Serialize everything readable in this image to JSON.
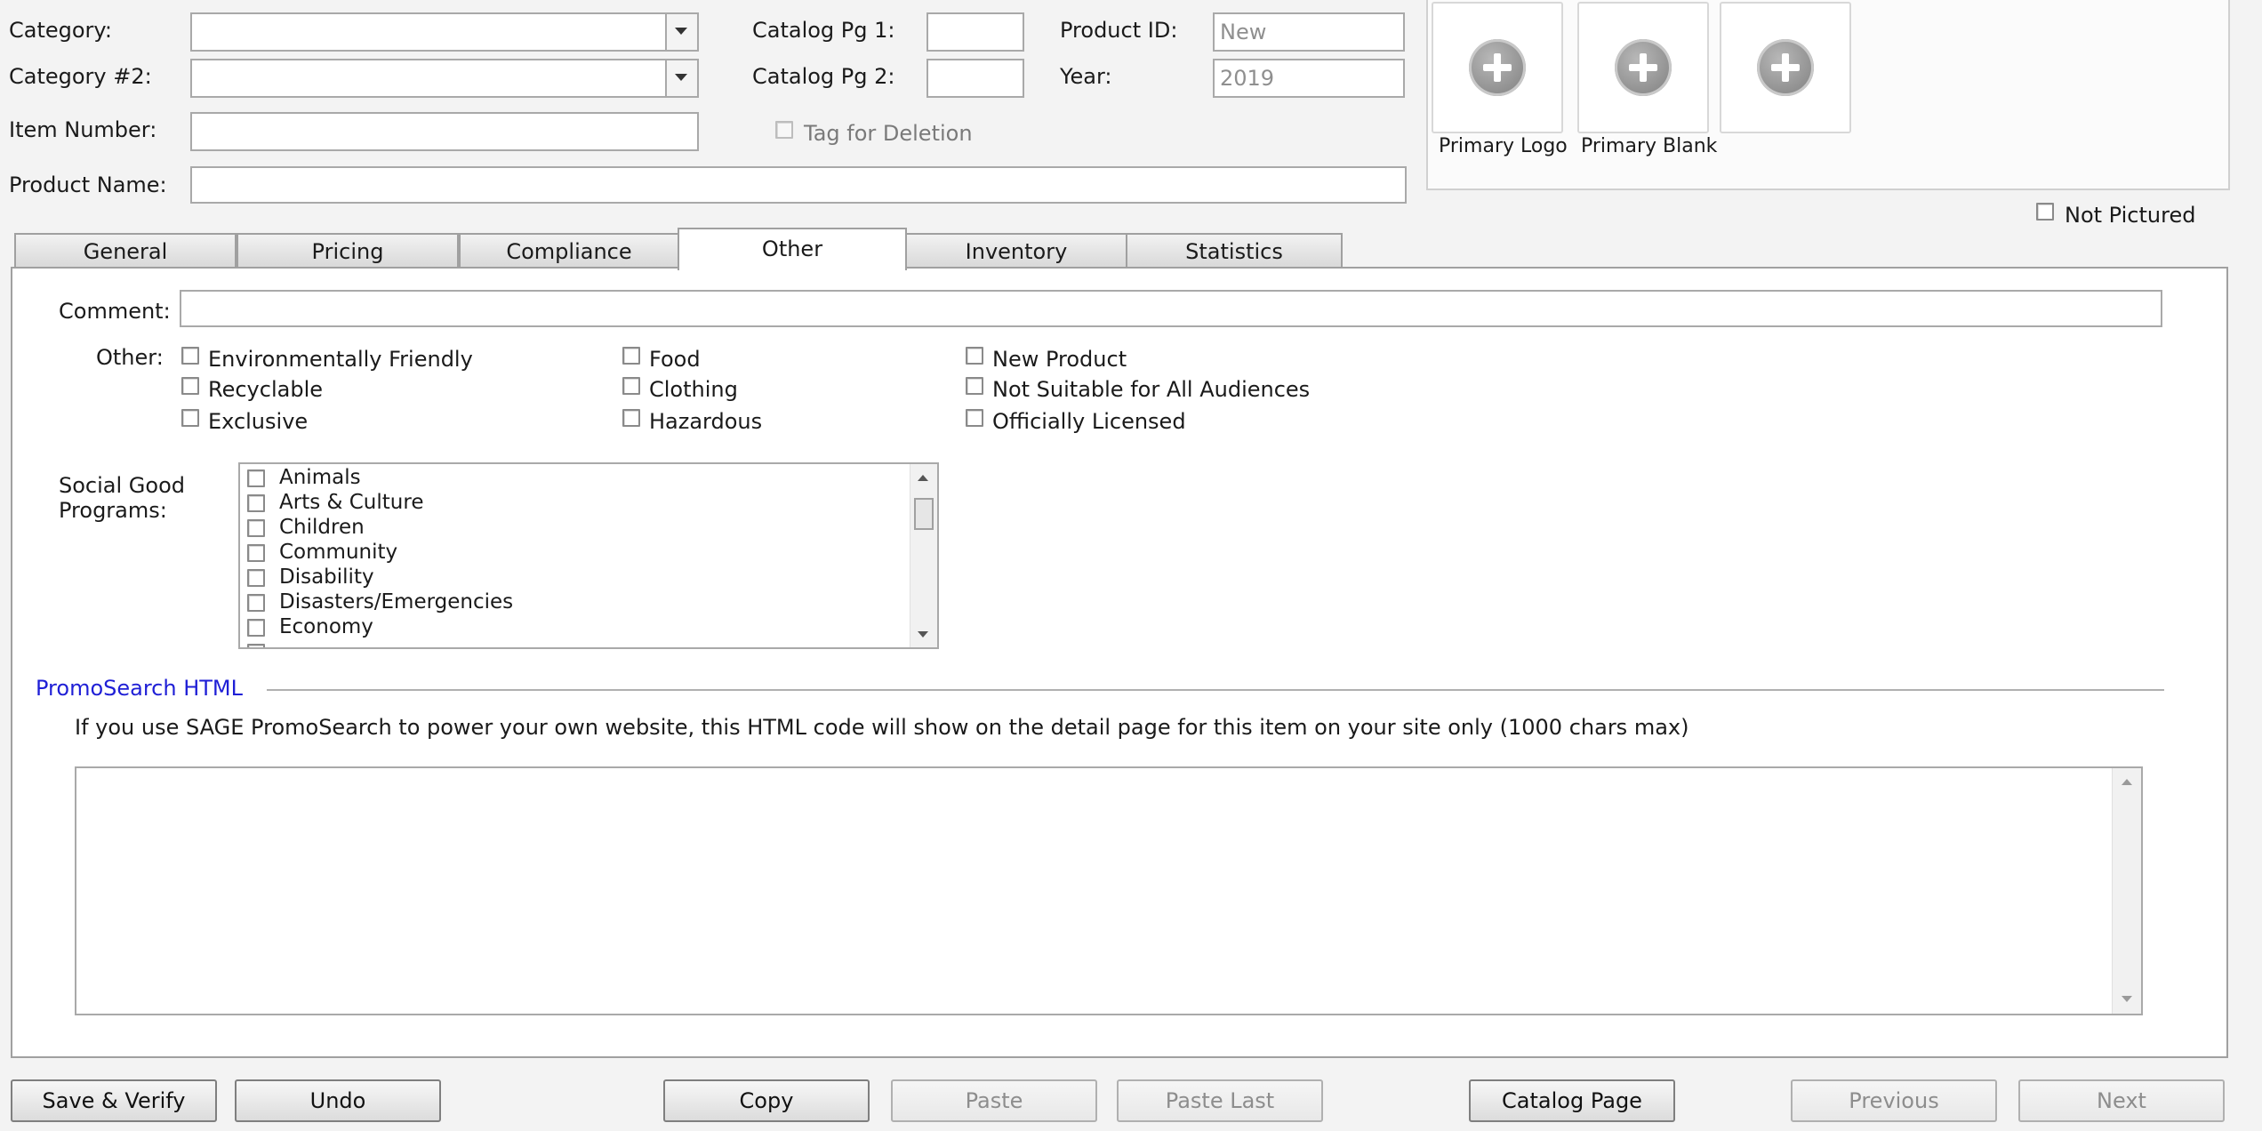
{
  "header": {
    "category_label": "Category:",
    "category2_label": "Category #2:",
    "item_number_label": "Item Number:",
    "product_name_label": "Product Name:",
    "catalog_pg1_label": "Catalog Pg 1:",
    "catalog_pg2_label": "Catalog Pg 2:",
    "product_id_label": "Product ID:",
    "product_id_value": "New",
    "year_label": "Year:",
    "year_value": "2019",
    "tag_for_deletion_label": "Tag for Deletion"
  },
  "images": {
    "tiles": [
      {
        "caption": "Primary Logo",
        "icon": "add-circle-icon"
      },
      {
        "caption": "Primary Blank",
        "icon": "add-circle-icon"
      },
      {
        "caption": "",
        "icon": "add-circle-icon"
      }
    ],
    "not_pictured_label": "Not Pictured"
  },
  "tabs": [
    {
      "label": "General"
    },
    {
      "label": "Pricing"
    },
    {
      "label": "Compliance"
    },
    {
      "label": "Other",
      "active": true
    },
    {
      "label": "Inventory"
    },
    {
      "label": "Statistics"
    }
  ],
  "other": {
    "comment_label": "Comment:",
    "other_label": "Other:",
    "checkboxes": [
      "Environmentally Friendly",
      "Recyclable",
      "Exclusive",
      "Food",
      "Clothing",
      "Hazardous",
      "New Product",
      "Not Suitable for All Audiences",
      "Officially Licensed"
    ],
    "social_good_label_line1": "Social Good",
    "social_good_label_line2": "Programs:",
    "social_good_programs": [
      "Animals",
      "Arts & Culture",
      "Children",
      "Community",
      "Disability",
      "Disasters/Emergencies",
      "Economy"
    ],
    "promosearch_title": "PromoSearch HTML",
    "promosearch_desc": "If you use SAGE PromoSearch to power your own website, this HTML code will show on the detail page for this item on your site only (1000 chars max)"
  },
  "buttons": {
    "save_verify": "Save & Verify",
    "undo": "Undo",
    "copy": "Copy",
    "paste": "Paste",
    "paste_last": "Paste Last",
    "catalog_page": "Catalog Page",
    "previous": "Previous",
    "next": "Next"
  },
  "colors": {
    "link_blue": "#1f1fd6",
    "background": "#f3f3f3"
  }
}
